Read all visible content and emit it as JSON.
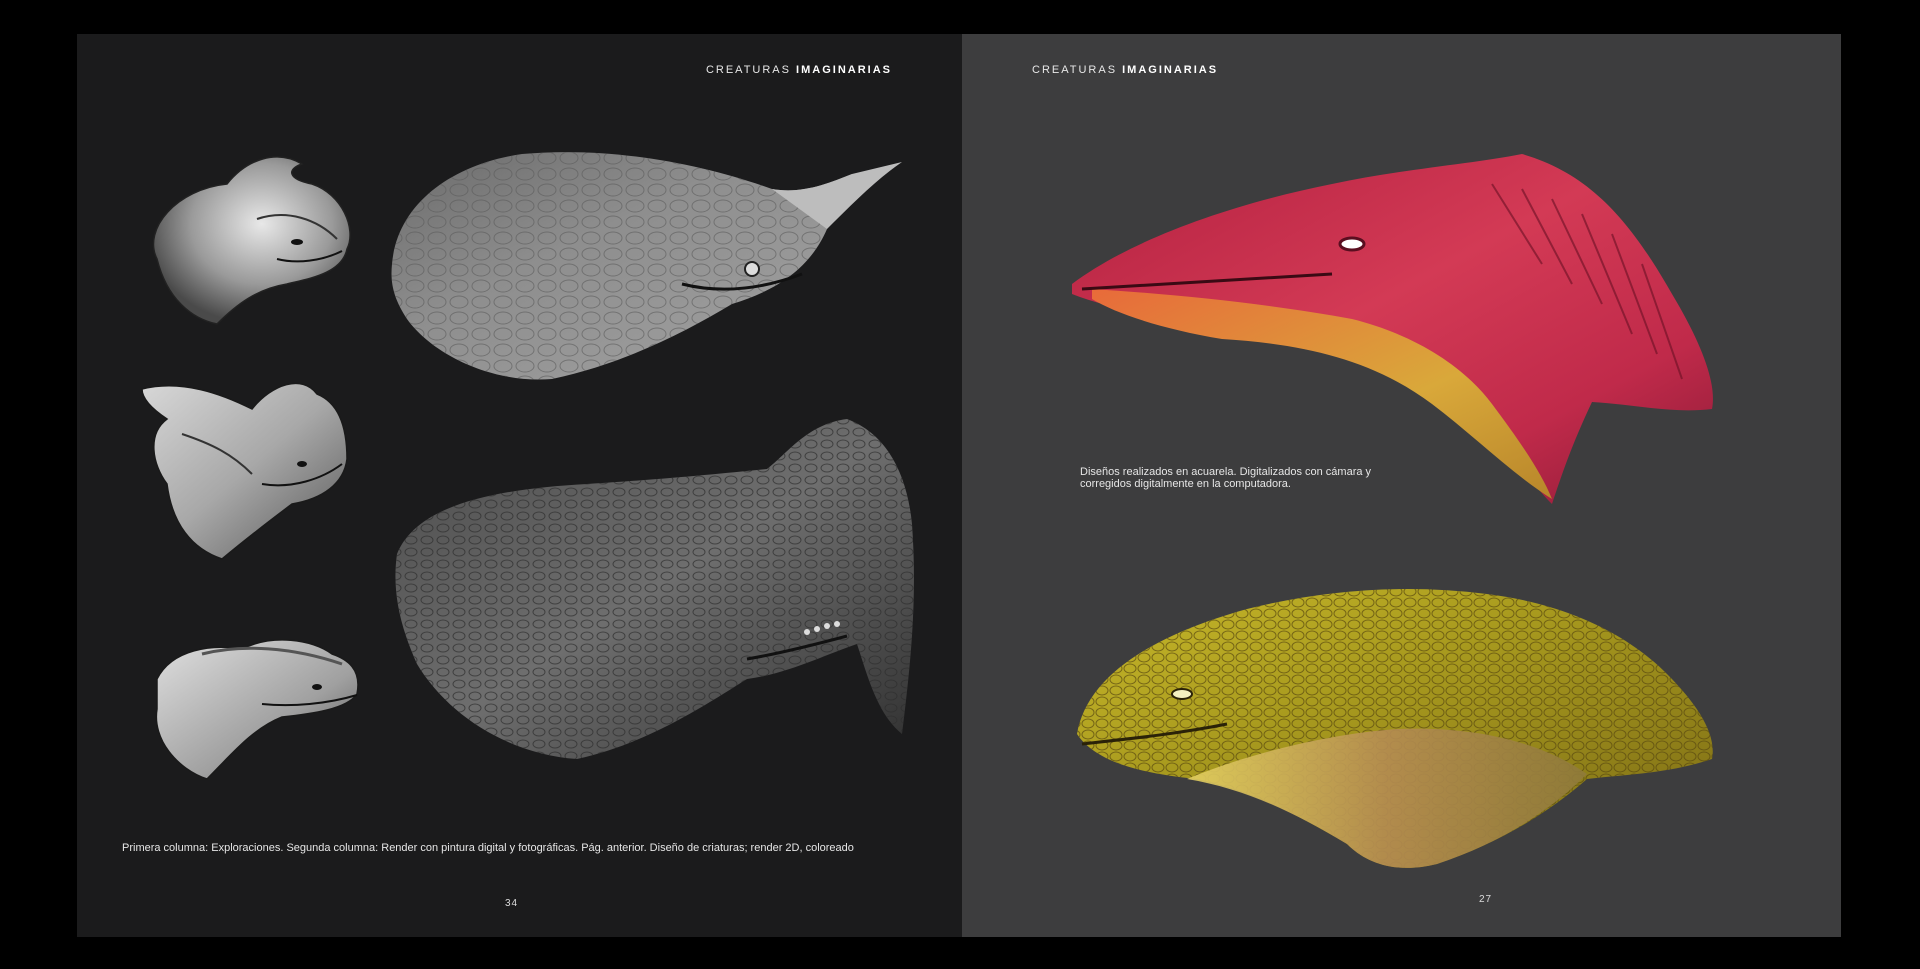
{
  "left_page": {
    "header_light": "CREATURAS",
    "header_bold": "IMAGINARIAS",
    "caption": "Primera columna: Exploraciones. Segunda columna: Render con pintura digital y fotográficas. Pág. anterior. Diseño de criaturas; render 2D, coloreado",
    "page_number": "34"
  },
  "right_page": {
    "header_light": "CREATURAS",
    "header_bold": "IMAGINARIAS",
    "caption": "Diseños realizados en acuarela. Digitalizados con cámara y corregidos digitalmente en la computadora.",
    "page_number": "27"
  },
  "colors": {
    "background": "#000000",
    "left_page": "#1b1b1c",
    "right_page": "#3d3d3e",
    "red_creature": "#c8324e",
    "yellow_creature": "#b0a420"
  },
  "illustrations": [
    "exploration-sketch-1",
    "exploration-sketch-2",
    "exploration-sketch-3",
    "armored-creature-render-1",
    "armored-creature-render-2",
    "red-creature-watercolor",
    "yellow-creature-watercolor"
  ]
}
